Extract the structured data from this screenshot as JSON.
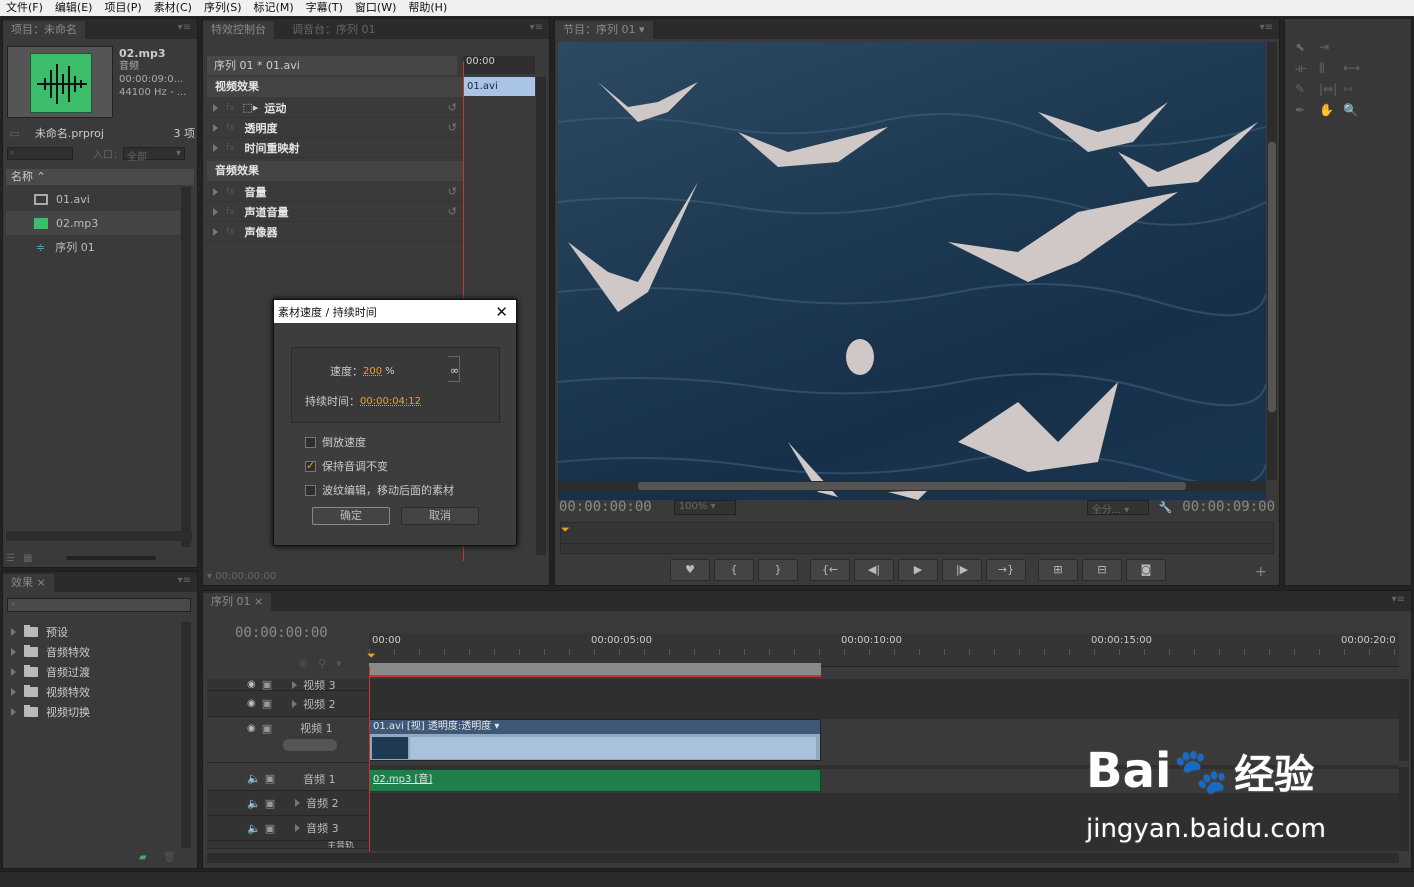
{
  "menu": [
    "文件(F)",
    "编辑(E)",
    "项目(P)",
    "素材(C)",
    "序列(S)",
    "标记(M)",
    "字幕(T)",
    "窗口(W)",
    "帮助(H)"
  ],
  "project": {
    "tab": "项目：未命名",
    "clip_name": "02.mp3",
    "clip_type": "音频",
    "clip_duration": "00:00:09:0...",
    "clip_rate": "44100 Hz - ...",
    "proj_file": "未命名.prproj",
    "item_count": "3 项",
    "entry_label": "入口：",
    "entry_value": "全部",
    "col_name": "名称",
    "items": [
      {
        "label": "01.avi",
        "icon": "video-file-icon"
      },
      {
        "label": "02.mp3",
        "icon": "audio-file-icon"
      },
      {
        "label": "序列 01",
        "icon": "sequence-icon"
      }
    ]
  },
  "effect_controls": {
    "tab1": "特效控制台",
    "tab2": "调音台：序列 01",
    "clip_path": "序列 01 * 01.avi",
    "ruler_time": "00:00",
    "clip_label": "01.avi",
    "video_fx": "视频效果",
    "video_items": [
      "运动",
      "透明度",
      "时间重映射"
    ],
    "audio_fx": "音频效果",
    "audio_items": [
      "音量",
      "声道音量",
      "声像器"
    ],
    "bottom_time": "00:00:00:00"
  },
  "dialog": {
    "title": "素材速度 / 持续时间",
    "speed_label": "速度：",
    "speed_value": "200",
    "speed_unit": "%",
    "duration_label": "持续时间：",
    "duration_value": "00:00:04:12",
    "opt_reverse": "倒放速度",
    "opt_pitch": "保持音调不变",
    "opt_ripple": "波纹编辑，移动后面的素材",
    "ok": "确定",
    "cancel": "取消"
  },
  "program": {
    "tab": "节目：序列 01",
    "time_left": "00:00:00:00",
    "zoom": "100%",
    "fit": "全分...",
    "time_right": "00:00:09:00"
  },
  "effects": {
    "tab": "效果",
    "folders": [
      "预设",
      "音频特效",
      "音频过渡",
      "视频特效",
      "视频切换"
    ]
  },
  "timeline": {
    "tab": "序列 01",
    "timecode": "00:00:00:00",
    "ruler": [
      "00:00",
      "00:00:05:00",
      "00:00:10:00",
      "00:00:15:00",
      "00:00:20:0"
    ],
    "tracks_video": [
      "视频 3",
      "视频 2",
      "视频 1"
    ],
    "tracks_audio": [
      "音频 1",
      "音频 2",
      "音频 3"
    ],
    "master": "主音轨",
    "video_clip": "01.avi [视] 透明度:透明度 ▾",
    "audio_clip": "02.mp3 [音]"
  },
  "watermark": {
    "brand": "Bai",
    "brand2": "经验",
    "url": "jingyan.baidu.com"
  }
}
